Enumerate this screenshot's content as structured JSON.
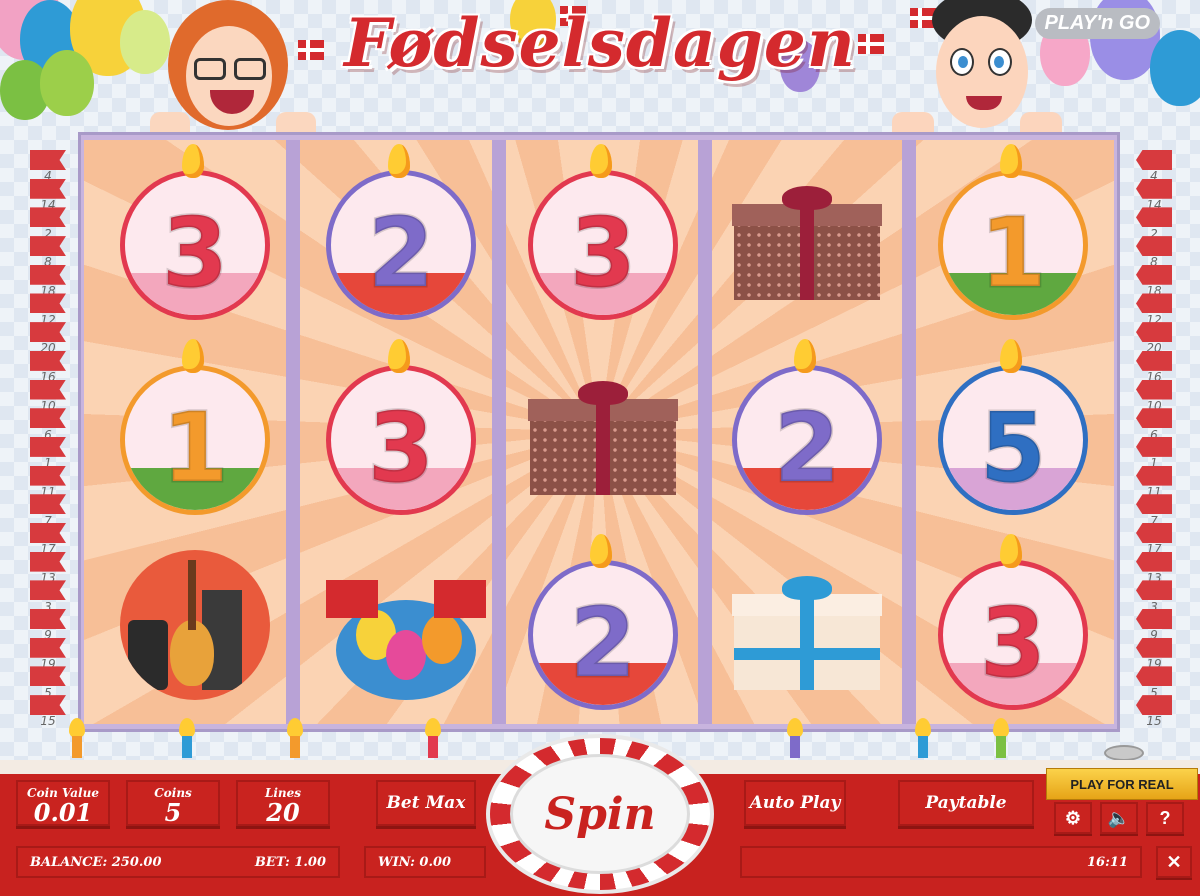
{
  "game": {
    "title": "Fødselsdagen",
    "brand": "PLAY'n GO"
  },
  "reels": [
    [
      {
        "type": "candle",
        "value": "3",
        "color": "#e2394f"
      },
      {
        "type": "candle",
        "value": "1",
        "color": "#f39a2c"
      },
      {
        "type": "music",
        "label": "music-instruments"
      }
    ],
    [
      {
        "type": "candle",
        "value": "2",
        "color": "#7e6bc9"
      },
      {
        "type": "candle",
        "value": "3",
        "color": "#e2394f"
      },
      {
        "type": "party",
        "label": "flags-balloons"
      }
    ],
    [
      {
        "type": "candle",
        "value": "3",
        "color": "#e2394f"
      },
      {
        "type": "gift",
        "label": "brown-gift"
      },
      {
        "type": "candle",
        "value": "2",
        "color": "#7e6bc9"
      }
    ],
    [
      {
        "type": "gift",
        "label": "brown-gift"
      },
      {
        "type": "candle",
        "value": "2",
        "color": "#7e6bc9"
      },
      {
        "type": "gift",
        "label": "white-blue-gift"
      }
    ],
    [
      {
        "type": "candle",
        "value": "1",
        "color": "#f39a2c"
      },
      {
        "type": "candle",
        "value": "5",
        "color": "#2f6fc2"
      },
      {
        "type": "candle",
        "value": "3",
        "color": "#e2394f"
      }
    ]
  ],
  "paylines_left": [
    "4",
    "14",
    "2",
    "8",
    "18",
    "12",
    "20",
    "16",
    "10",
    "6",
    "1",
    "11",
    "7",
    "17",
    "13",
    "3",
    "9",
    "19",
    "5",
    "15"
  ],
  "paylines_right": [
    "4",
    "14",
    "2",
    "8",
    "18",
    "12",
    "20",
    "16",
    "10",
    "6",
    "1",
    "11",
    "7",
    "17",
    "13",
    "3",
    "9",
    "19",
    "5",
    "15"
  ],
  "controls": {
    "coin_value_label": "Coin Value",
    "coin_value": "0.01",
    "coins_label": "Coins",
    "coins": "5",
    "lines_label": "Lines",
    "lines": "20",
    "bet_max": "Bet Max",
    "spin": "Spin",
    "auto_play": "Auto Play",
    "paytable": "Paytable",
    "play_for_real": "PLAY FOR REAL",
    "settings_icon": "gear-icon",
    "sound_icon": "speaker-icon",
    "help": "?",
    "close": "✕"
  },
  "status": {
    "balance": "BALANCE: 250.00",
    "bet": "BET: 1.00",
    "win": "WIN: 0.00",
    "time": "16:11"
  },
  "colors": {
    "brand_red": "#c9231f",
    "gold": "#fbd24a"
  }
}
